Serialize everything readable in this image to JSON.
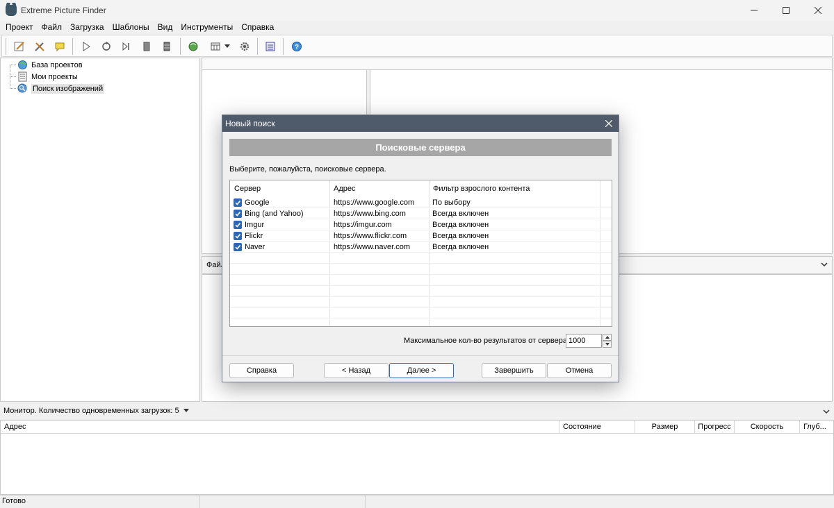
{
  "window": {
    "title": "Extreme Picture Finder"
  },
  "menu": [
    "Проект",
    "Файл",
    "Загрузка",
    "Шаблоны",
    "Вид",
    "Инструменты",
    "Справка"
  ],
  "tree": {
    "items": [
      {
        "label": "База проектов",
        "icon": "globe-database-icon"
      },
      {
        "label": "Мои проекты",
        "icon": "projects-list-icon"
      },
      {
        "label": "Поиск изображений",
        "icon": "search-globe-icon",
        "selected": true
      }
    ]
  },
  "panels": {
    "files_tab": "Файл"
  },
  "dialog": {
    "title": "Новый поиск",
    "banner": "Поисковые сервера",
    "prompt": "Выберите, пожалуйста, поисковые сервера.",
    "columns": [
      "Сервер",
      "Адрес",
      "Фильтр взрослого контента"
    ],
    "servers": [
      {
        "name": "Google",
        "address": "https://www.google.com",
        "filter": "По выбору",
        "checked": true
      },
      {
        "name": "Bing (and Yahoo)",
        "address": "https://www.bing.com",
        "filter": "Всегда включен",
        "checked": true
      },
      {
        "name": "Imgur",
        "address": "https://imgur.com",
        "filter": "Всегда включен",
        "checked": true
      },
      {
        "name": "Flickr",
        "address": "https://www.flickr.com",
        "filter": "Всегда включен",
        "checked": true
      },
      {
        "name": "Naver",
        "address": "https://www.naver.com",
        "filter": "Всегда включен",
        "checked": true
      }
    ],
    "max_results_label": "Максимальное кол-во результатов от сервера",
    "max_results_value": "1000",
    "buttons": {
      "help": "Справка",
      "back": "< Назад",
      "next": "Далее >",
      "finish": "Завершить",
      "cancel": "Отмена"
    }
  },
  "monitor": {
    "label": "Монитор. Количество одновременных загрузок: 5",
    "columns": [
      "Адрес",
      "Состояние",
      "Размер",
      "Прогресс",
      "Скорость",
      "Глуб..."
    ]
  },
  "status": {
    "text": "Готово"
  },
  "colors": {
    "dialog_title_bg": "#4f5b6b",
    "banner_bg": "#a6a6a6",
    "checkbox": "#2c67b8"
  }
}
